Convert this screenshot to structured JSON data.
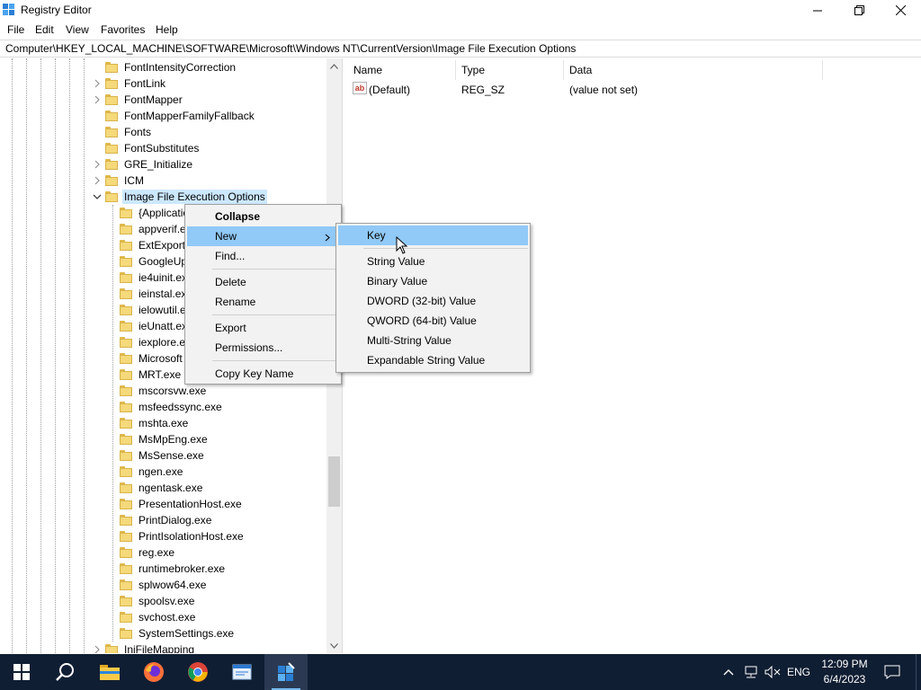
{
  "window": {
    "title": "Registry Editor",
    "controls": {
      "minimize": "minimize",
      "maximize": "restore",
      "close": "close"
    }
  },
  "menubar": [
    "File",
    "Edit",
    "View",
    "Favorites",
    "Help"
  ],
  "address": "Computer\\HKEY_LOCAL_MACHINE\\SOFTWARE\\Microsoft\\Windows NT\\CurrentVersion\\Image File Execution Options",
  "tree": {
    "parent_items": [
      {
        "label": "FontIntensityCorrection",
        "expandable": false
      },
      {
        "label": "FontLink",
        "expandable": true
      },
      {
        "label": "FontMapper",
        "expandable": true
      },
      {
        "label": "FontMapperFamilyFallback",
        "expandable": false
      },
      {
        "label": "Fonts",
        "expandable": false
      },
      {
        "label": "FontSubstitutes",
        "expandable": false
      },
      {
        "label": "GRE_Initialize",
        "expandable": true
      },
      {
        "label": "ICM",
        "expandable": true
      },
      {
        "label": "Image File Execution Options",
        "expandable": true,
        "expanded": true,
        "selected": true
      }
    ],
    "child_items": [
      "{Applicatio",
      "appverif.e",
      "ExtExport",
      "GoogleUp",
      "ie4uinit.ex",
      "ieinstal.ex",
      "ielowutil.e",
      "ieUnatt.ex",
      "iexplore.e",
      "Microsoft",
      "MRT.exe",
      "mscorsvw.exe",
      "msfeedssync.exe",
      "mshta.exe",
      "MsMpEng.exe",
      "MsSense.exe",
      "ngen.exe",
      "ngentask.exe",
      "PresentationHost.exe",
      "PrintDialog.exe",
      "PrintIsolationHost.exe",
      "reg.exe",
      "runtimebroker.exe",
      "splwow64.exe",
      "spoolsv.exe",
      "svchost.exe",
      "SystemSettings.exe"
    ],
    "trailing_item": "IniFileMapping"
  },
  "values": {
    "columns": [
      "Name",
      "Type",
      "Data"
    ],
    "rows": [
      {
        "name": "(Default)",
        "type": "REG_SZ",
        "data": "(value not set)",
        "icon": "string-value-icon"
      }
    ]
  },
  "context_menu": {
    "items": [
      {
        "label": "Collapse",
        "bold": true
      },
      {
        "label": "New",
        "submenu": true,
        "highlighted": true
      },
      {
        "label": "Find..."
      },
      {
        "separator": true
      },
      {
        "label": "Delete"
      },
      {
        "label": "Rename"
      },
      {
        "separator": true
      },
      {
        "label": "Export"
      },
      {
        "label": "Permissions..."
      },
      {
        "separator": true
      },
      {
        "label": "Copy Key Name"
      }
    ]
  },
  "new_submenu": {
    "items": [
      {
        "label": "Key",
        "highlighted": true
      },
      {
        "separator": true
      },
      {
        "label": "String Value"
      },
      {
        "label": "Binary Value"
      },
      {
        "label": "DWORD (32-bit) Value"
      },
      {
        "label": "QWORD (64-bit) Value"
      },
      {
        "label": "Multi-String Value"
      },
      {
        "label": "Expandable String Value"
      }
    ]
  },
  "taskbar": {
    "apps": [
      "start-icon",
      "search-icon",
      "file-explorer-icon",
      "firefox-icon",
      "chrome-icon",
      "notepad-icon",
      "regedit-icon"
    ],
    "language": "ENG",
    "time": "12:09 PM",
    "date": "6/4/2023"
  },
  "colors": {
    "selection": "#cce8ff",
    "menu_highlight": "#91c9f7",
    "taskbar": "#101e33",
    "folder": "#f5d97a"
  }
}
